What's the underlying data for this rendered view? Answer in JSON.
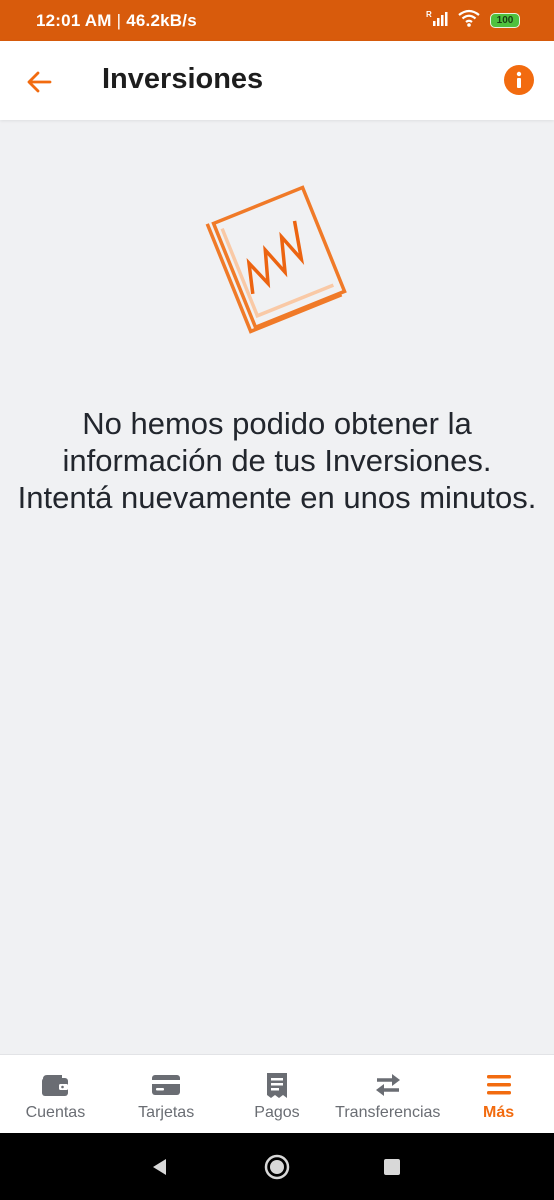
{
  "status_bar": {
    "time": "12:01 AM",
    "separator": "|",
    "network_speed": "46.2kB/s",
    "battery_level": "100",
    "icons": [
      "signal-roaming-icon",
      "wifi-icon",
      "battery-icon"
    ]
  },
  "header": {
    "title": "Inversiones",
    "back_icon": "arrow-left-icon",
    "info_icon": "info-icon"
  },
  "empty_state": {
    "illustration": "investment-chart-icon",
    "message_lines": [
      "No hemos podido obtener la",
      "información de tus Inversiones.",
      "Intentá nuevamente en unos minutos."
    ]
  },
  "bottom_nav": {
    "items": [
      {
        "label": "Cuentas",
        "icon": "wallet-icon",
        "active": false
      },
      {
        "label": "Tarjetas",
        "icon": "credit-card-icon",
        "active": false
      },
      {
        "label": "Pagos",
        "icon": "receipt-icon",
        "active": false
      },
      {
        "label": "Transferencias",
        "icon": "transfer-arrows-icon",
        "active": false
      },
      {
        "label": "Más",
        "icon": "menu-icon",
        "active": true
      }
    ]
  },
  "colors": {
    "accent": "#f26b0f",
    "status_bar": "#d85b0c",
    "background": "#f0f1f3",
    "nav_inactive": "#6a6d73"
  }
}
